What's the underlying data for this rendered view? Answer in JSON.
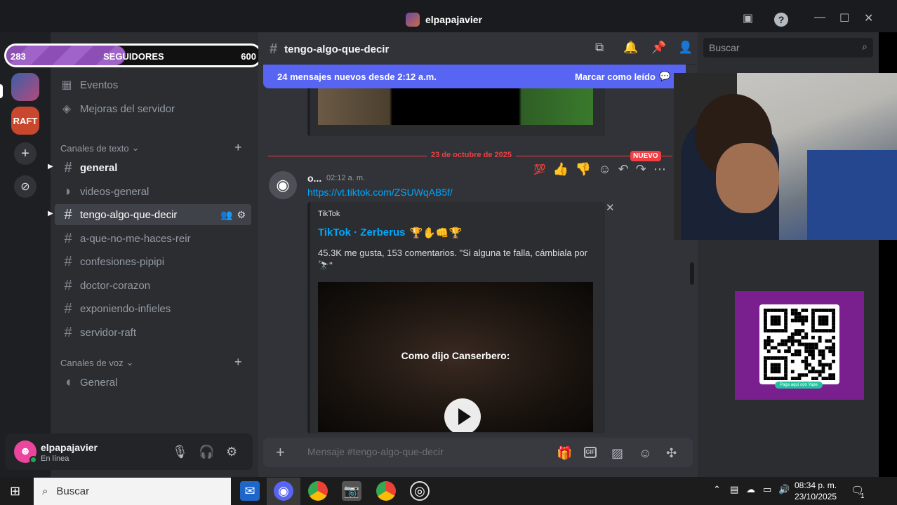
{
  "window": {
    "title": "elpapajavier"
  },
  "followers_bar": {
    "current": "283",
    "label": "SEGUIDORES",
    "goal": "600",
    "progress": 0.47
  },
  "sidebar": {
    "items": [
      {
        "label": "Eventos",
        "icon": "calendar-icon"
      },
      {
        "label": "Mejoras del servidor",
        "icon": "boost-icon"
      }
    ],
    "text_category": "Canales de texto",
    "text_channels": [
      {
        "name": "general",
        "state": "unread"
      },
      {
        "name": "videos-general",
        "state": "normal"
      },
      {
        "name": "tengo-algo-que-decir",
        "state": "active"
      },
      {
        "name": "a-que-no-me-haces-reir",
        "state": "normal"
      },
      {
        "name": "confesiones-pipipi",
        "state": "normal"
      },
      {
        "name": "doctor-corazon",
        "state": "normal"
      },
      {
        "name": "exponiendo-infieles",
        "state": "normal"
      },
      {
        "name": "servidor-raft",
        "state": "normal"
      }
    ],
    "voice_category": "Canales de voz",
    "voice_channels": [
      {
        "name": "General"
      }
    ]
  },
  "user": {
    "name": "elpapajavier",
    "status": "En línea"
  },
  "header": {
    "channel": "tengo-algo-que-decir",
    "search_placeholder": "Buscar"
  },
  "new_messages": {
    "text": "24 mensajes nuevos desde 2:12 a.m.",
    "action": "Marcar como leído"
  },
  "divider": {
    "date": "23 de octubre de 2025",
    "badge": "NUEVO"
  },
  "message": {
    "author": "o...",
    "time": "02:12 a. m.",
    "link": "https://vt.tiktok.com/ZSUWqAB5f/",
    "embed": {
      "provider": "TikTok",
      "title": "TikTok · Zerberus",
      "title_emojis": "🏆✋👊🏆",
      "description": "45.3K me gusta, 153 comentarios. \"Si alguna te falla, cámbiala por",
      "description2": "🔭\"",
      "video_caption": "Como dijo Canserbero:"
    }
  },
  "composer": {
    "placeholder": "Mensaje #tengo-algo-que-decir"
  },
  "taskbar": {
    "search": "Buscar",
    "time": "08:34 p. m.",
    "date": "23/10/2025",
    "notif_count": "1"
  },
  "raft_label": "RAFT",
  "qr_caption": "Paga aquí con Yape"
}
